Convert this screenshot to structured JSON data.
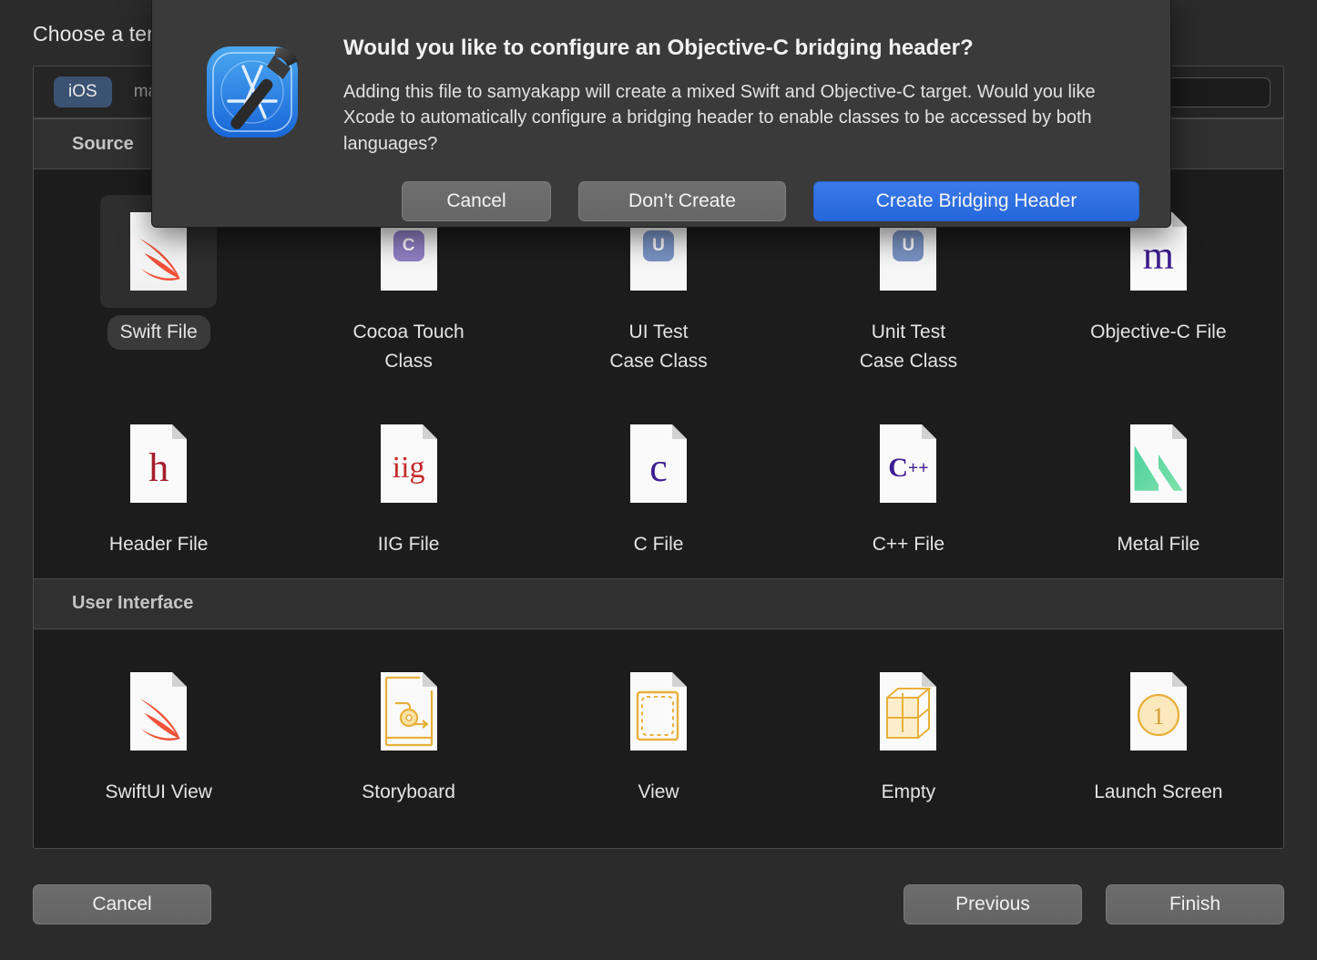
{
  "sheet": {
    "title": "Choose a template for your new file:",
    "platform_tabs": [
      {
        "label": "iOS",
        "selected": true
      },
      {
        "label": "macOS",
        "selected": false
      }
    ],
    "search": {
      "value": "",
      "placeholder": ""
    },
    "sections": [
      {
        "header": "Source",
        "rows": [
          [
            {
              "label": "Swift File",
              "icon": "swift-file-icon",
              "selected": true
            },
            {
              "label": "Cocoa Touch\nClass",
              "icon": "cocoa-touch-class-icon",
              "selected": false
            },
            {
              "label": "UI Test\nCase Class",
              "icon": "ui-test-case-class-icon",
              "selected": false
            },
            {
              "label": "Unit Test\nCase Class",
              "icon": "unit-test-case-class-icon",
              "selected": false
            },
            {
              "label": "Objective-C File",
              "icon": "objective-c-file-icon",
              "selected": false
            }
          ],
          [
            {
              "label": "Header File",
              "icon": "header-file-icon",
              "selected": false
            },
            {
              "label": "IIG File",
              "icon": "iig-file-icon",
              "selected": false
            },
            {
              "label": "C File",
              "icon": "c-file-icon",
              "selected": false
            },
            {
              "label": "C++ File",
              "icon": "cpp-file-icon",
              "selected": false
            },
            {
              "label": "Metal File",
              "icon": "metal-file-icon",
              "selected": false
            }
          ]
        ]
      },
      {
        "header": "User Interface",
        "rows": [
          [
            {
              "label": "SwiftUI View",
              "icon": "swiftui-view-icon",
              "selected": false
            },
            {
              "label": "Storyboard",
              "icon": "storyboard-icon",
              "selected": false
            },
            {
              "label": "View",
              "icon": "view-icon",
              "selected": false
            },
            {
              "label": "Empty",
              "icon": "empty-icon",
              "selected": false
            },
            {
              "label": "Launch Screen",
              "icon": "launch-screen-icon",
              "selected": false
            }
          ]
        ]
      }
    ],
    "footer": {
      "cancel": "Cancel",
      "previous": "Previous",
      "finish": "Finish"
    }
  },
  "alert": {
    "app_icon": "xcode-app-icon",
    "title": "Would you like to configure an Objective-C bridging header?",
    "message": "Adding this file to samyakapp will create a mixed Swift and Objective-C target. Would you like Xcode to automatically configure a bridging header to enable classes to be accessed by both languages?",
    "buttons": {
      "cancel": "Cancel",
      "dont_create": "Don’t Create",
      "create": "Create Bridging Header"
    }
  },
  "colors": {
    "accent_blue": "#2e6fe0",
    "tab_selected": "#3b5272",
    "window_bg": "#2b2b2b",
    "grid_bg": "#1c1c1c",
    "alert_bg": "#3a3a3a",
    "swift_orange": "#f05138",
    "objc_indigo": "#3d1d8f",
    "header_crimson": "#a51c2c",
    "metal_green": "#4fd391",
    "ib_gold": "#e8b03a"
  }
}
